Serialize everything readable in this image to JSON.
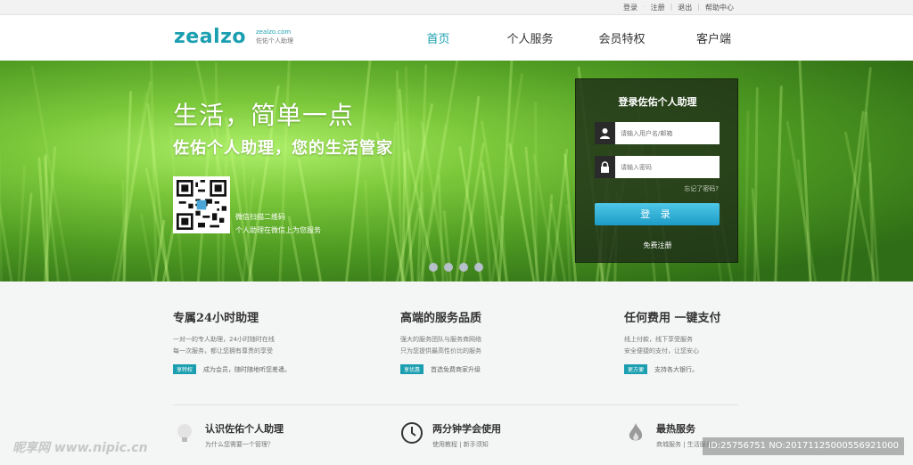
{
  "topbar": {
    "login": "登录",
    "register": "注册",
    "logout": "退出",
    "help": "帮助中心"
  },
  "header": {
    "logo": "zealzo",
    "logo_domain": "zealzo.com",
    "logo_tagline": "佐佑个人助理",
    "nav": [
      {
        "label": "首页",
        "active": true
      },
      {
        "label": "个人服务"
      },
      {
        "label": "会员特权"
      },
      {
        "label": "客户端"
      }
    ]
  },
  "hero": {
    "title": "生活，简单一点",
    "subtitle": "佐佑个人助理，您的生活管家",
    "qr_line1": "微信扫描二维码",
    "qr_line2": "个人助理在微信上为您服务",
    "slide_count": 4
  },
  "login": {
    "title": "登录佐佑个人助理",
    "username_placeholder": "请输入用户名/邮箱",
    "password_placeholder": "请输入密码",
    "forgot": "忘记了密码?",
    "button": "登 录",
    "register": "免费注册"
  },
  "features": [
    {
      "title": "专属24小时助理",
      "desc1": "一对一的专人助理，24小时随时在线",
      "desc2": "每一次服务，都让您拥有尊贵的享受",
      "tag": "享特权",
      "tag_text": "成为会员，随时随地听您差遣。"
    },
    {
      "title": "高端的服务品质",
      "desc1": "强大的服务团队与服务商网络",
      "desc2": "只为您提供最高性价比的服务",
      "tag": "享优惠",
      "tag_text": "首选免费商家升级"
    },
    {
      "title": "任何费用 一键支付",
      "desc1": "线上付款，线下享受服务",
      "desc2": "安全便捷的支付，让您安心",
      "tag": "更方便",
      "tag_text": "支持各大银行。"
    }
  ],
  "bottom": [
    {
      "title": "认识佐佑个人助理",
      "sub": "为什么您需要一个管理？",
      "icon": "bulb-icon"
    },
    {
      "title": "两分钟学会使用",
      "sub": "使用教程 | 新手须知",
      "icon": "clock-icon"
    },
    {
      "title": "最热服务",
      "sub": "商城服务 | 生活服务",
      "icon": "flame-icon"
    }
  ],
  "watermarks": {
    "left": "昵享网 www.nipic.cn",
    "right": "ID:25756751 NO:20171125000556921000"
  },
  "colors": {
    "accent": "#1b9fb0",
    "button": "#1d9cc6"
  }
}
